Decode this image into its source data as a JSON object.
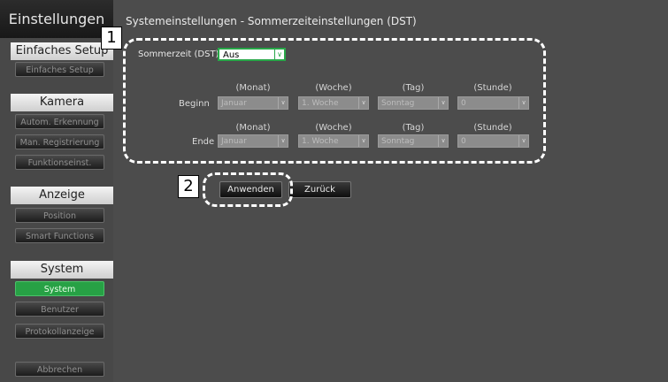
{
  "sidebar": {
    "title": "Einstellungen",
    "sections": [
      {
        "header": "Einfaches Setup",
        "items": [
          "Einfaches Setup"
        ]
      },
      {
        "header": "Kamera",
        "items": [
          "Autom. Erkennung",
          "Man. Registrierung",
          "Funktionseinst."
        ]
      },
      {
        "header": "Anzeige",
        "items": [
          "Position",
          "Smart Functions"
        ]
      },
      {
        "header": "System",
        "items": [
          "System",
          "Benutzer",
          "Protokollanzeige"
        ]
      }
    ],
    "cancel_label": "Abbrechen"
  },
  "main": {
    "title": "Systemeinstellungen - Sommerzeiteinstellungen (DST)",
    "dst": {
      "label": "Sommerzeit (DST)",
      "value": "Aus"
    },
    "columns": [
      "(Monat)",
      "(Woche)",
      "(Tag)",
      "(Stunde)"
    ],
    "rows": [
      {
        "label": "Beginn",
        "values": [
          "Januar",
          "1. Woche",
          "Sonntag",
          "0"
        ]
      },
      {
        "label": "Ende",
        "values": [
          "Januar",
          "1. Woche",
          "Sonntag",
          "0"
        ]
      }
    ],
    "apply_label": "Anwenden",
    "back_label": "Zurück"
  },
  "callouts": [
    "1",
    "2"
  ],
  "colors": {
    "accent": "#27a145",
    "panel": "#4c4c4c",
    "sidebar": "#484848"
  }
}
